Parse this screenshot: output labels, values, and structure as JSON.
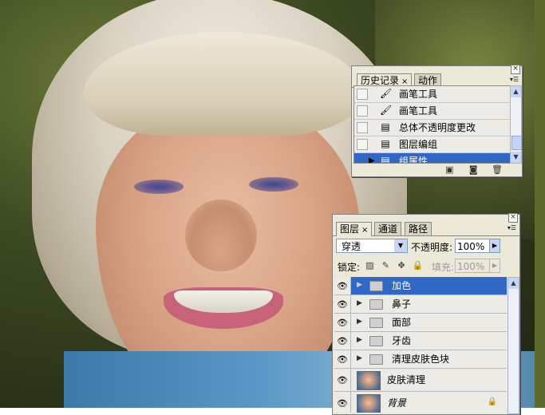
{
  "history_panel": {
    "tabs": [
      {
        "label": "历史记录",
        "active": true,
        "closable": true
      },
      {
        "label": "动作",
        "active": false,
        "closable": false
      }
    ],
    "items": [
      {
        "label": "画笔工具",
        "icon": "brush-icon",
        "selected": false
      },
      {
        "label": "画笔工具",
        "icon": "brush-icon",
        "selected": false
      },
      {
        "label": "总体不透明度更改",
        "icon": "document-icon",
        "selected": false
      },
      {
        "label": "图层编组",
        "icon": "document-icon",
        "selected": false
      },
      {
        "label": "组属性",
        "icon": "document-icon",
        "selected": true
      }
    ],
    "footer_icons": [
      "new-document-icon",
      "snapshot-camera-icon",
      "trash-icon"
    ]
  },
  "layers_panel": {
    "tabs": [
      {
        "label": "图层",
        "active": true,
        "closable": true
      },
      {
        "label": "通道",
        "active": false,
        "closable": false
      },
      {
        "label": "路径",
        "active": false,
        "closable": false
      }
    ],
    "blend_mode": "穿透",
    "opacity_label": "不透明度:",
    "opacity_value": "100%",
    "lock_label": "锁定:",
    "fill_label": "填充:",
    "fill_value": "100%",
    "layers": [
      {
        "name": "加色",
        "type": "group",
        "selected": true
      },
      {
        "name": "鼻子",
        "type": "group",
        "selected": false
      },
      {
        "name": "面部",
        "type": "group",
        "selected": false
      },
      {
        "name": "牙齿",
        "type": "group",
        "selected": false
      },
      {
        "name": "清理皮肤色块",
        "type": "group",
        "selected": false
      },
      {
        "name": "皮肤清理",
        "type": "image",
        "selected": false
      },
      {
        "name": "背景",
        "type": "image",
        "selected": false,
        "locked": true
      }
    ]
  },
  "colors": {
    "selection": "#3168c6",
    "panel_bg": "#ece9d8"
  }
}
